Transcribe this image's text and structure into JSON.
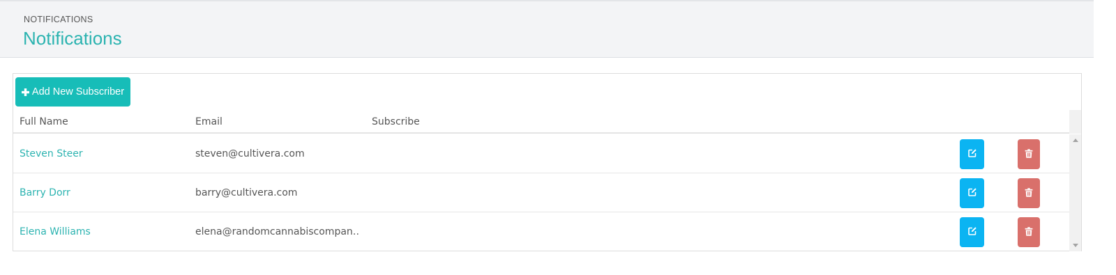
{
  "header": {
    "breadcrumb": "NOTIFICATIONS",
    "title": "Notifications"
  },
  "toolbar": {
    "add_label": "Add New Subscriber",
    "add_icon": "plus-icon"
  },
  "grid": {
    "columns": [
      "Full Name",
      "Email",
      "Subscribe"
    ],
    "rows": [
      {
        "name": "Steven Steer",
        "email": "steven@cultivera.com"
      },
      {
        "name": "Barry Dorr",
        "email": "barry@cultivera.com"
      },
      {
        "name": "Elena Williams",
        "email": "elena@randomcannabiscompan…"
      }
    ],
    "edit_icon": "edit-icon",
    "delete_icon": "trash-icon"
  },
  "colors": {
    "accent": "#2bb3b0",
    "add_button": "#17bdb8",
    "edit_button": "#0bb4f2",
    "delete_button": "#d9706b",
    "header_bg": "#f3f4f6"
  }
}
